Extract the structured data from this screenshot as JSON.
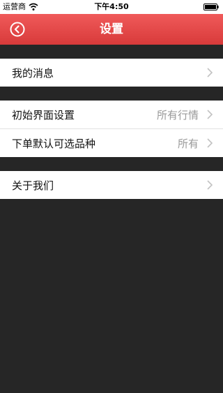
{
  "status_bar": {
    "carrier": "运营商",
    "time": "下午4:50",
    "icons": [
      "wifi-icon",
      "battery-icon"
    ]
  },
  "nav": {
    "title": "设置",
    "back_icon": "circle-left-chevron-icon"
  },
  "groups": [
    {
      "items": [
        {
          "label": "我的消息",
          "value": ""
        }
      ]
    },
    {
      "items": [
        {
          "label": "初始界面设置",
          "value": "所有行情"
        },
        {
          "label": "下单默认可选品种",
          "value": "所有"
        }
      ]
    },
    {
      "items": [
        {
          "label": "关于我们",
          "value": ""
        }
      ]
    }
  ],
  "colors": {
    "nav_bar": "#e24848",
    "background": "#262626",
    "row_background": "#ffffff",
    "value_text": "#9a9a9a"
  }
}
